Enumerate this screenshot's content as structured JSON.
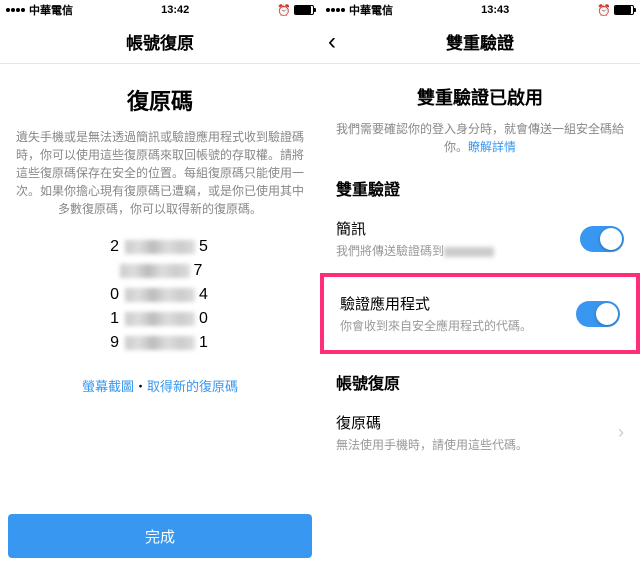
{
  "left": {
    "carrier": "中華電信",
    "time": "13:42",
    "navTitle": "帳號復原",
    "heading": "復原碼",
    "description": "遺失手機或是無法透過簡訊或驗證應用程式收到驗證碼時，你可以使用這些復原碼來取回帳號的存取權。請將這些復原碼保存在安全的位置。每組復原碼只能使用一次。如果你擔心現有復原碼已遭竊，或是你已使用其中多數復原碼，你可以取得新的復原碼。",
    "codes": [
      {
        "first": "2",
        "last": "5"
      },
      {
        "first": "",
        "last": "7"
      },
      {
        "first": "0",
        "last": "4"
      },
      {
        "first": "1",
        "last": "0"
      },
      {
        "first": "9",
        "last": "1"
      }
    ],
    "screenshotLink": "螢幕截圖",
    "dot": "・",
    "newCodesLink": "取得新的復原碼",
    "doneLabel": "完成"
  },
  "right": {
    "carrier": "中華電信",
    "time": "13:43",
    "navTitle": "雙重驗證",
    "heading": "雙重驗證已啟用",
    "description": "我們需要確認你的登入身分時，就會傳送一組安全碼給你。",
    "learnMore": "瞭解詳情",
    "section1": "雙重驗證",
    "smsTitle": "簡訊",
    "smsSubPrefix": "我們將傳送驗證碼到",
    "appTitle": "驗證應用程式",
    "appSub": "你會收到來自安全應用程式的代碼。",
    "section2": "帳號復原",
    "recoveryTitle": "復原碼",
    "recoverySub": "無法使用手機時，請使用這些代碼。"
  }
}
